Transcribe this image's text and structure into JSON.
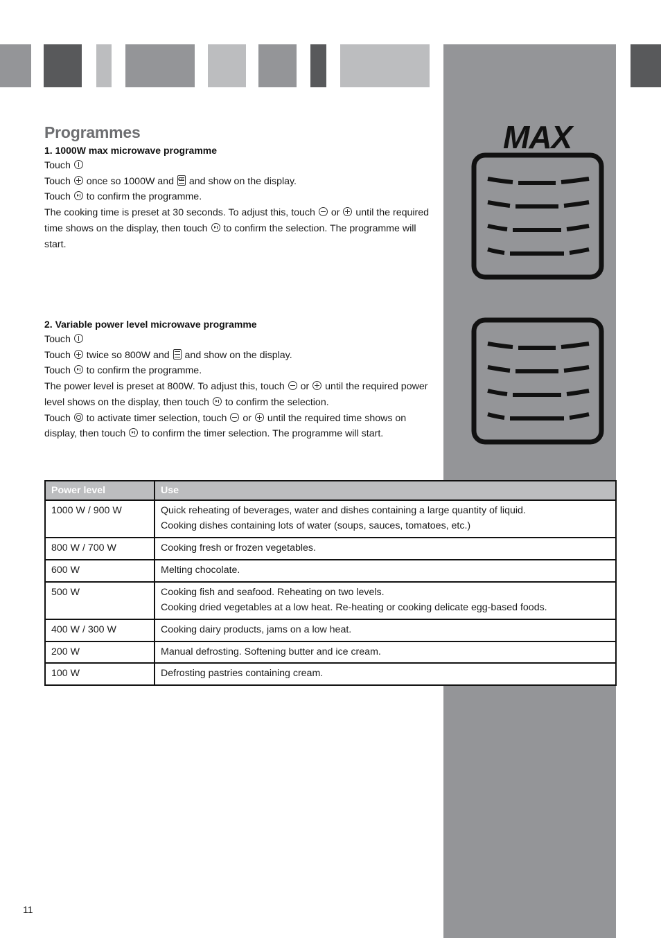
{
  "header": {
    "decor_bars": [
      {
        "tone": "mid"
      },
      {
        "tone": "dark"
      },
      {
        "tone": "light"
      },
      {
        "tone": "mid"
      },
      {
        "tone": "light"
      },
      {
        "tone": "mid"
      },
      {
        "tone": "dark"
      },
      {
        "tone": "light"
      },
      {
        "tone": "mid"
      },
      {
        "tone": "dark"
      }
    ],
    "colors": {
      "mid": "#949598",
      "dark": "#58595b",
      "light": "#bcbdbf"
    }
  },
  "page": {
    "title": "Programmes",
    "page_number": "11"
  },
  "section1": {
    "heading": "1. 1000W max microwave programme",
    "line1_prefix": "Touch",
    "line1_icon": "power-icon",
    "line2_prefix": "Touch",
    "line2_icon": "plus-icon",
    "line2_mid": "once so 1000W and",
    "line2_icon2": "max-display-icon",
    "line2_suffix": "and show on the display.",
    "line3_prefix": "Touch",
    "line3_icon": "start-pause-icon",
    "line3_suffix": "to confirm the programme.",
    "para_a": "The cooking time is preset at 30 seconds.  To adjust this, touch",
    "para_or": "or",
    "para_b": "until the required time shows on the display, then touch",
    "para_c": "to confirm the selection. The programme will start."
  },
  "section2": {
    "heading": "2. Variable power level microwave programme",
    "line1_prefix": "Touch",
    "line2_prefix": "Touch",
    "line2_mid": "twice so 800W and",
    "line2_suffix": "and show on the display.",
    "line3_prefix": "Touch",
    "line3_suffix": "to confirm the programme.",
    "para1_a": "The power level is preset at 800W.  To adjust this, touch",
    "para1_or": "or",
    "para1_b": "until the required power level shows on the display, then touch",
    "para1_c": "to confirm the selection.",
    "para2_a": "Touch",
    "para2_b": "to activate timer selection, touch",
    "para2_or": "or",
    "para2_c": "until the required time shows on display, then touch",
    "para2_d": "to confirm the timer selection.  The programme will start."
  },
  "side_icons": {
    "max_label": "MAX",
    "icon1": "max-microwave-display-icon",
    "icon2": "microwave-display-icon"
  },
  "table": {
    "headers": [
      "Power level",
      "Use"
    ],
    "rows": [
      {
        "level": "1000 W / 900 W",
        "use": [
          "Quick reheating of beverages, water and dishes containing a large quantity of liquid.",
          "Cooking dishes containing lots of water (soups, sauces, tomatoes, etc.)"
        ]
      },
      {
        "level": "800 W / 700 W",
        "use": [
          "Cooking fresh or frozen vegetables."
        ]
      },
      {
        "level": "600 W",
        "use": [
          "Melting chocolate."
        ]
      },
      {
        "level": "500 W",
        "use": [
          "Cooking fish and seafood. Reheating on two levels.",
          "Cooking dried vegetables at a low heat. Re-heating or cooking delicate egg-based foods."
        ]
      },
      {
        "level": "400 W / 300 W",
        "use": [
          "Cooking dairy products, jams on a low heat."
        ]
      },
      {
        "level": "200 W",
        "use": [
          "Manual defrosting. Softening butter and ice cream."
        ]
      },
      {
        "level": "100 W",
        "use": [
          "Defrosting pastries containing cream."
        ]
      }
    ]
  }
}
